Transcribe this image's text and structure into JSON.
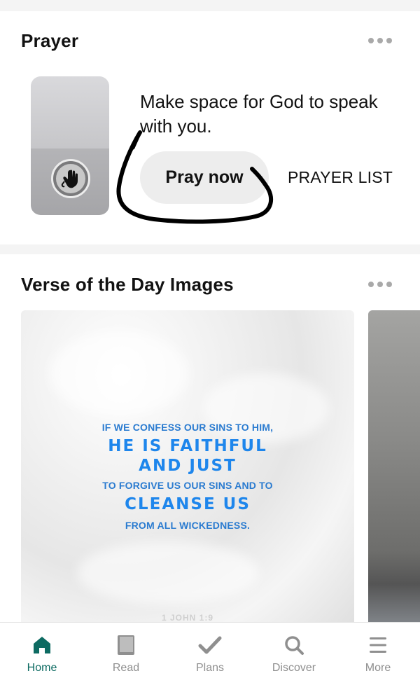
{
  "prayer": {
    "title": "Prayer",
    "menu_icon": "more-horizontal-icon",
    "widget_icon": "praying-hands-icon",
    "message": "Make space for God to speak with you.",
    "pray_button_label": "Pray now",
    "prayer_list_label": "PRAYER LIST"
  },
  "verse": {
    "title": "Verse of the Day Images",
    "menu_icon": "more-horizontal-icon",
    "image": {
      "line1": "IF WE CONFESS OUR SINS TO HIM,",
      "line2": "HE IS FAITHFUL",
      "line3": "AND JUST",
      "line4": "TO FORGIVE US OUR SINS AND TO",
      "line5": "CLEANSE US",
      "line6": "FROM ALL WICKEDNESS.",
      "reference": "1 JOHN 1:9"
    }
  },
  "nav": {
    "items": [
      {
        "label": "Home",
        "icon": "home-icon",
        "active": true
      },
      {
        "label": "Read",
        "icon": "book-icon",
        "active": false
      },
      {
        "label": "Plans",
        "icon": "checkmark-icon",
        "active": false
      },
      {
        "label": "Discover",
        "icon": "search-icon",
        "active": false
      },
      {
        "label": "More",
        "icon": "menu-icon",
        "active": false
      }
    ],
    "active_color": "#0d6b62",
    "inactive_color": "#8f8f8f"
  }
}
